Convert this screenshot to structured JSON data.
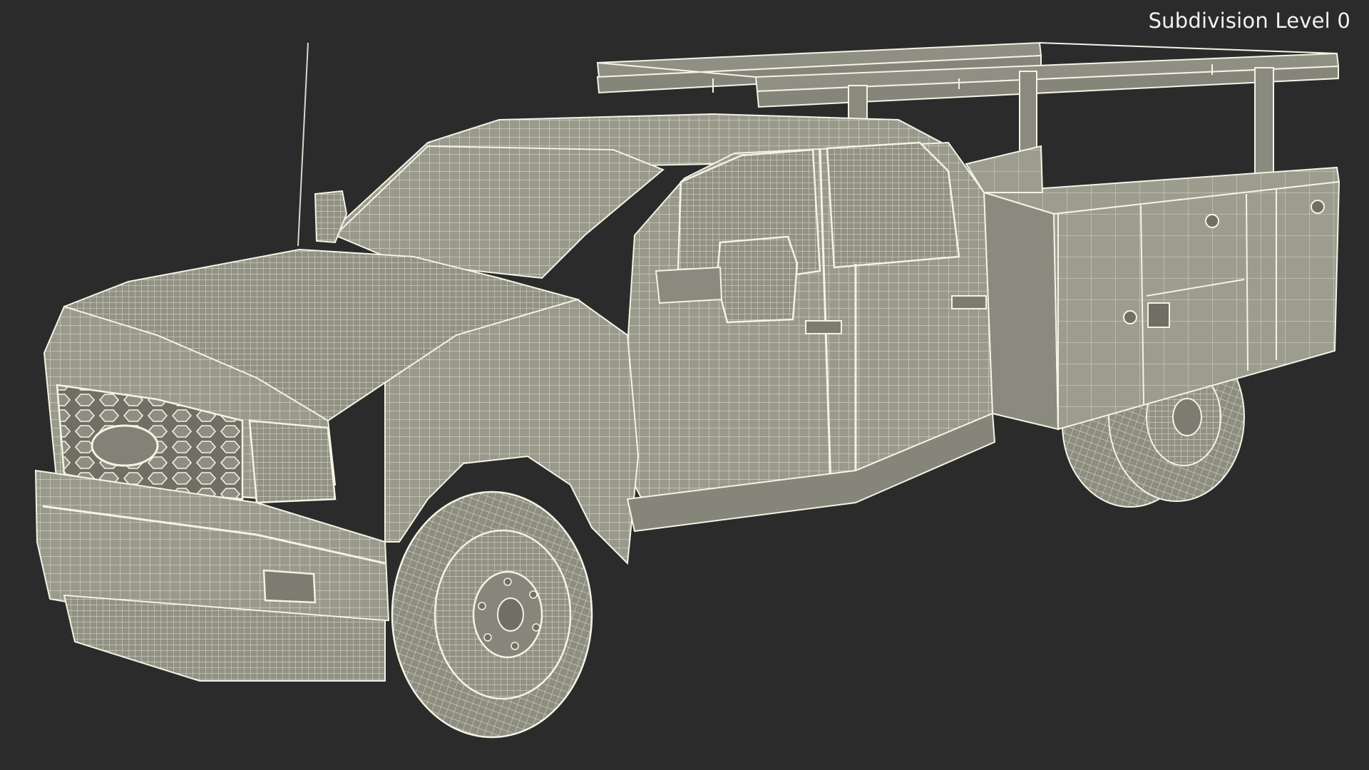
{
  "overlay": {
    "subdivision_label": "Subdivision Level 0"
  },
  "model": {
    "subject": "pickup-truck-with-utility-body-wireframe",
    "colors": {
      "background": "#2b2b2b",
      "surface": "#9a9a8c",
      "wire": "#f3f3e6",
      "shadow": "#75756a"
    }
  }
}
